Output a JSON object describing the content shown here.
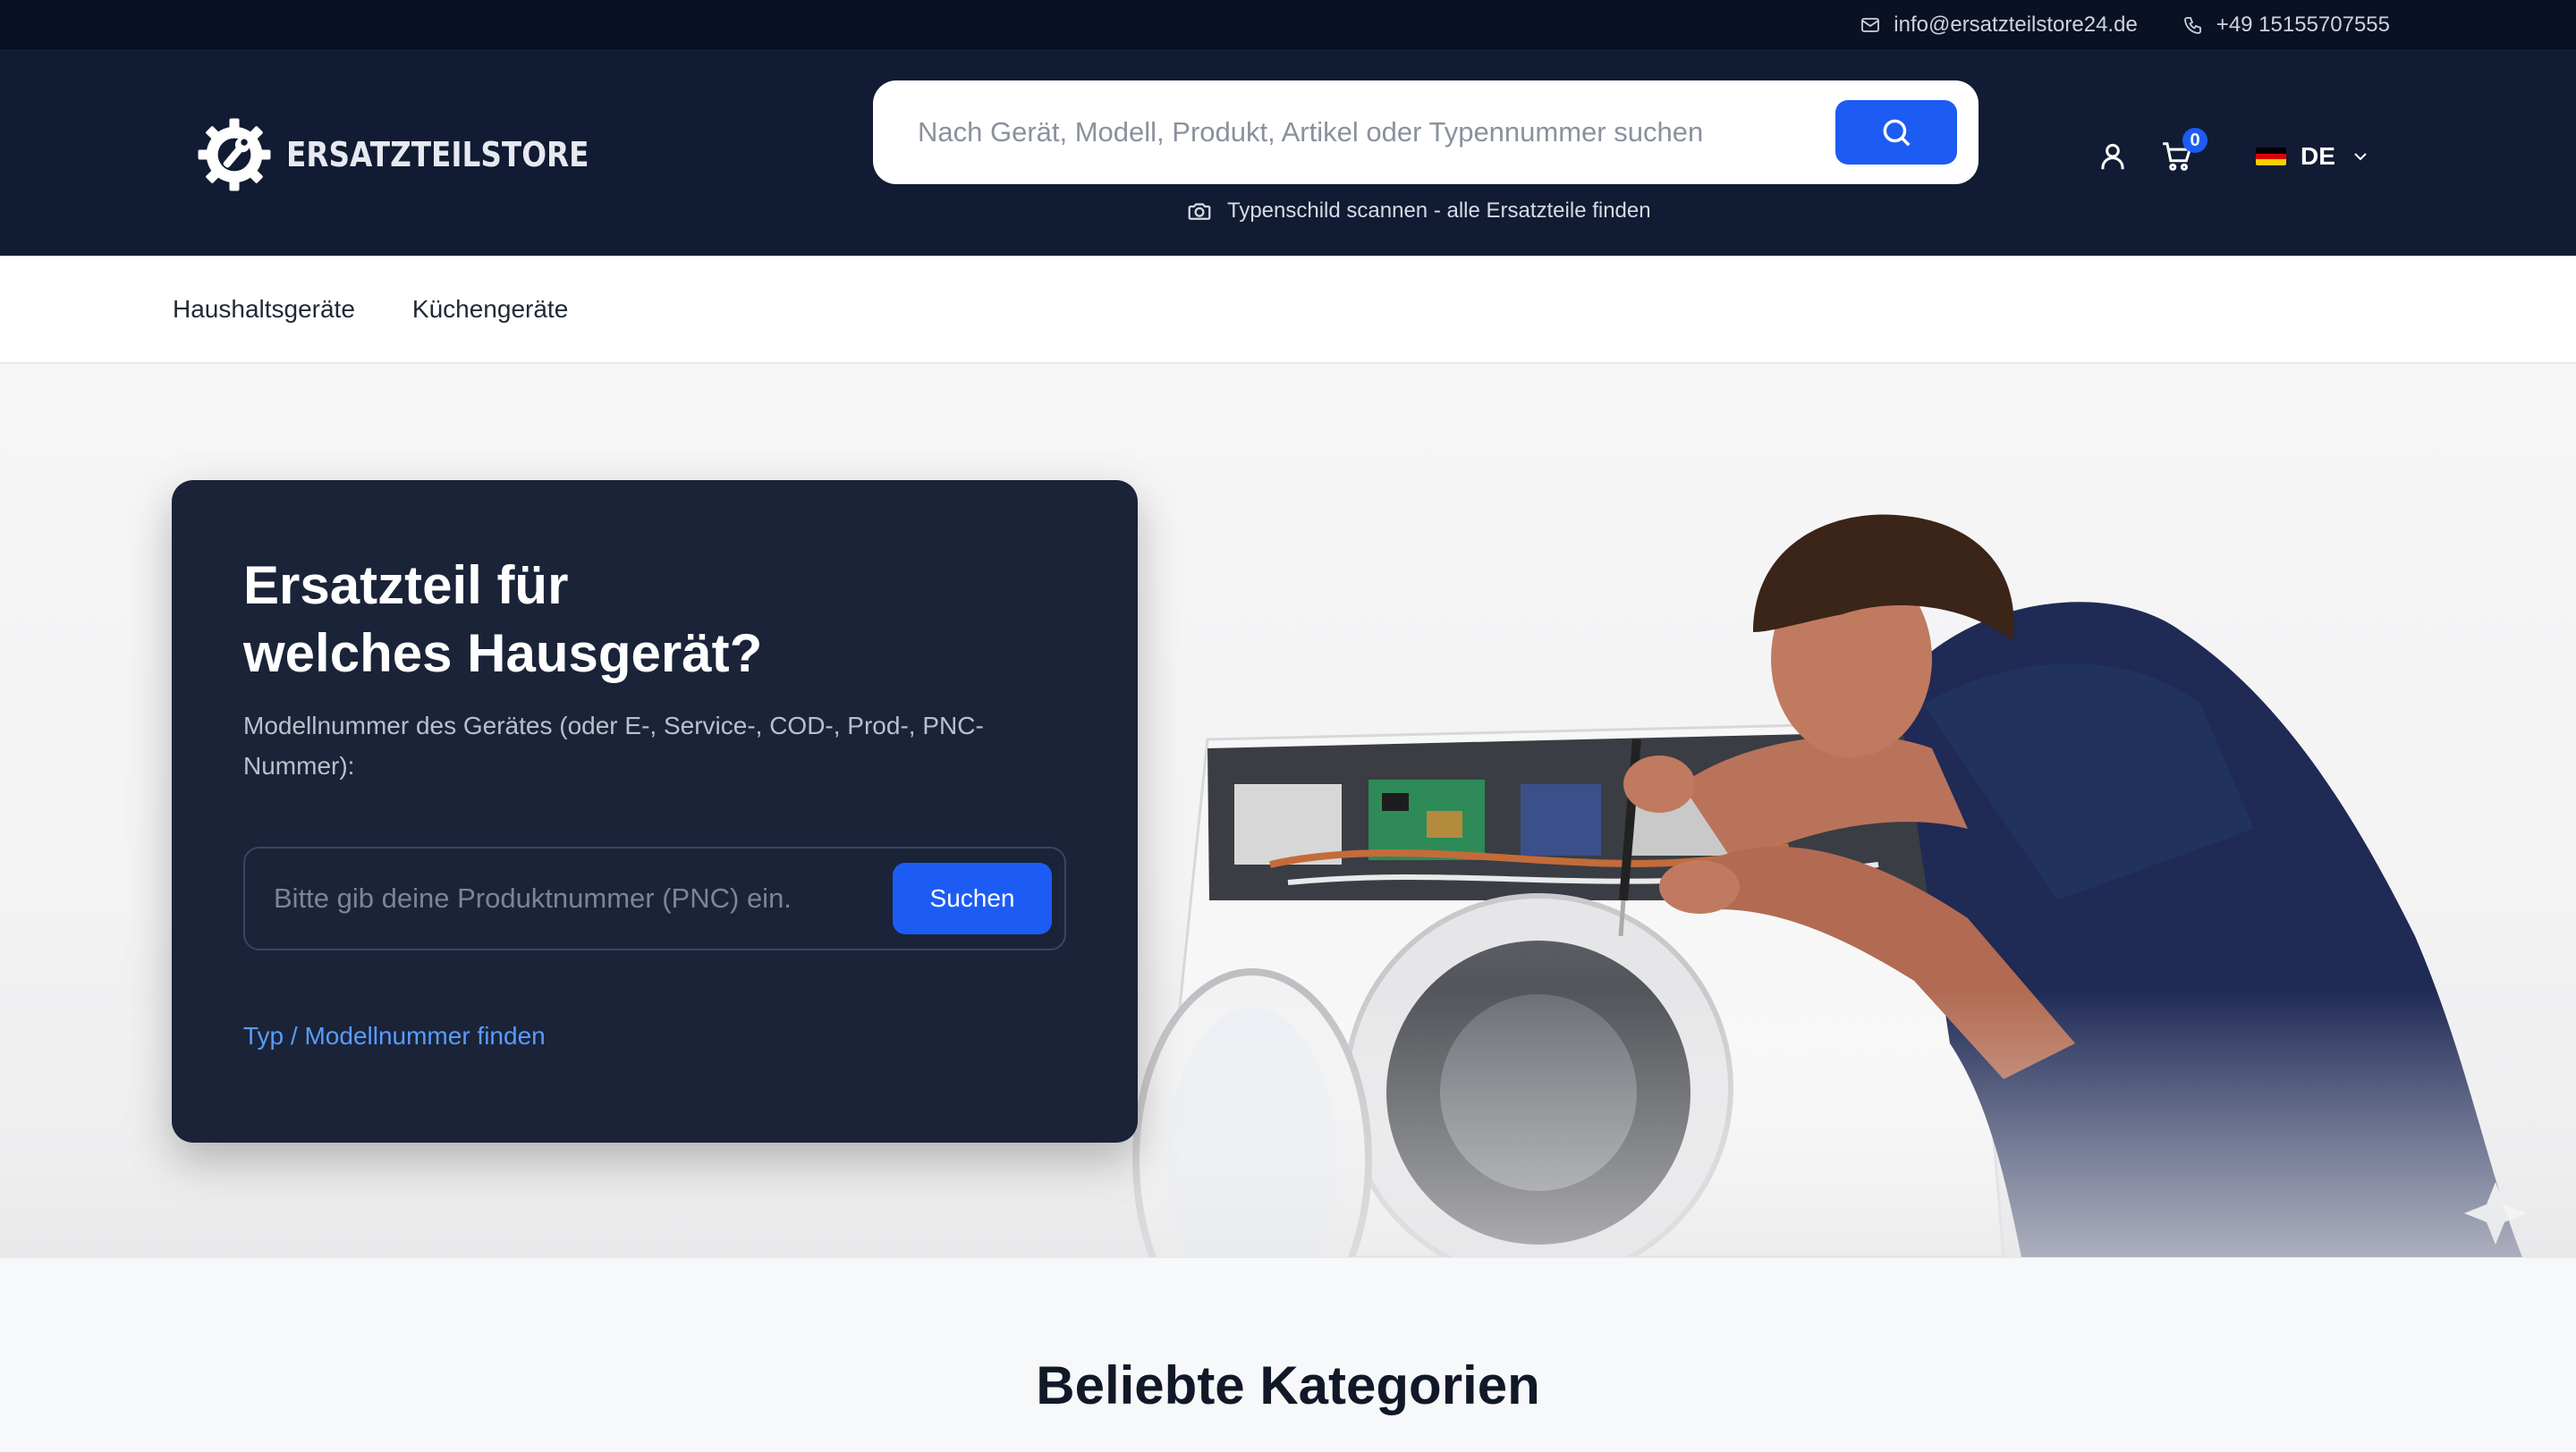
{
  "topbar": {
    "email": "info@ersatzteilstore24.de",
    "phone": "+49 15155707555"
  },
  "header": {
    "logo_text": "ERSATZTEILSTORE",
    "search_placeholder": "Nach Gerät, Modell, Produkt, Artikel oder Typennummer suchen",
    "scan_link": "Typenschild scannen - alle Ersatzteile finden",
    "cart_count": "0",
    "language": "DE"
  },
  "nav": {
    "items": [
      "Haushaltsgeräte",
      "Küchengeräte"
    ]
  },
  "hero": {
    "title": "Ersatzteil für\nwelches Hausgerät?",
    "subtitle": "Modellnummer des Gerätes (oder E-, Service-, COD-, Prod-, PNC-Nummer):",
    "input_placeholder": "Bitte gib deine Produktnummer (PNC) ein.",
    "button_label": "Suchen",
    "find_link": "Typ / Modellnummer finden"
  },
  "categories": {
    "title": "Beliebte Kategorien"
  },
  "colors": {
    "topbar_bg": "#0a1124",
    "header_bg": "#111b33",
    "accent": "#1c5cf5",
    "card_bg": "#1a2338",
    "link": "#5a9bff"
  },
  "icons": {
    "email": "envelope-icon",
    "phone": "phone-icon",
    "search": "search-icon",
    "camera": "camera-icon",
    "account": "user-icon",
    "cart": "cart-icon",
    "dropdown": "chevron-down-icon"
  }
}
